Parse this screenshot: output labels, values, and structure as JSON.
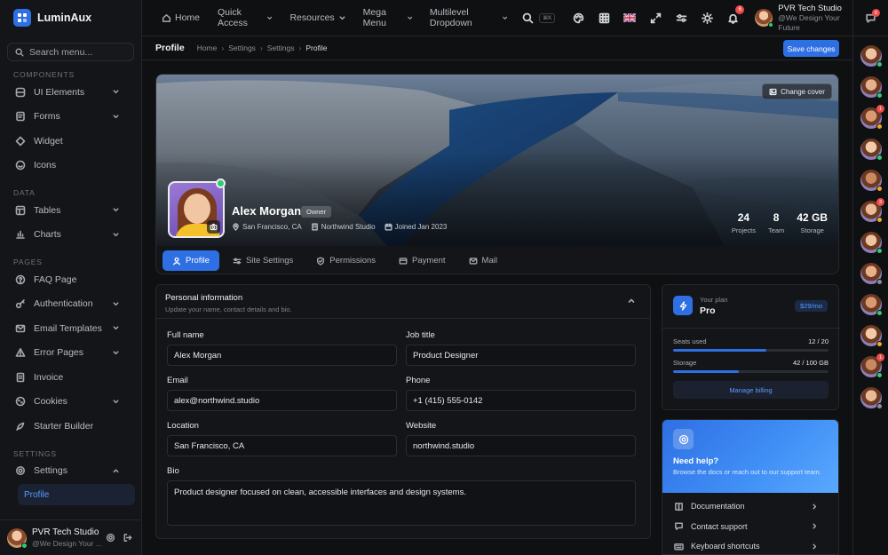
{
  "brand": {
    "name": "LuminAux"
  },
  "sidebar": {
    "search_placeholder": "Search menu...",
    "sections": {
      "components": "COMPONENTS",
      "data": "DATA",
      "pages": "PAGES",
      "settings": "SETTINGS"
    },
    "components": [
      {
        "label": "UI Elements",
        "icon": "grid-icon",
        "chevron": true
      },
      {
        "label": "Forms",
        "icon": "form-icon",
        "chevron": true
      },
      {
        "label": "Widget",
        "icon": "widget-icon",
        "chevron": false
      },
      {
        "label": "Icons",
        "icon": "smile-icon",
        "chevron": false
      }
    ],
    "data": [
      {
        "label": "Tables",
        "icon": "table-icon",
        "chevron": true
      },
      {
        "label": "Charts",
        "icon": "chart-icon",
        "chevron": true
      }
    ],
    "pages": [
      {
        "label": "FAQ Page",
        "icon": "help-circle-icon",
        "chevron": false
      },
      {
        "label": "Authentication",
        "icon": "key-icon",
        "chevron": true
      },
      {
        "label": "Email Templates",
        "icon": "mail-icon",
        "chevron": true
      },
      {
        "label": "Error Pages",
        "icon": "alert-icon",
        "chevron": true
      },
      {
        "label": "Invoice",
        "icon": "invoice-icon",
        "chevron": false
      },
      {
        "label": "Cookies",
        "icon": "cookie-icon",
        "chevron": true
      },
      {
        "label": "Starter Builder",
        "icon": "rocket-icon",
        "chevron": false
      }
    ],
    "settings": {
      "label": "Settings",
      "sub_active": "Profile"
    },
    "user": {
      "name": "PVR Tech Studio",
      "sub": "@We Design Your ..."
    }
  },
  "topbar": {
    "nav": [
      {
        "label": "Home",
        "icon": "home-icon",
        "chevron": false
      },
      {
        "label": "Quick Access",
        "chevron": true
      },
      {
        "label": "Resources",
        "chevron": true
      },
      {
        "label": "Mega Menu",
        "chevron": true
      },
      {
        "label": "Multilevel Dropdown",
        "chevron": true
      }
    ],
    "search_kbd": "⌘K",
    "notifications_count": "6",
    "user": {
      "name": "PVR Tech Studio",
      "sub": "@We Design Your Future"
    }
  },
  "rail": {
    "chat_badge": "6",
    "avatars": [
      {
        "status": "#2ecc71",
        "badge": ""
      },
      {
        "status": "#2ecc71",
        "badge": ""
      },
      {
        "status": "#f5a623",
        "badge": "1"
      },
      {
        "status": "#2ecc71",
        "badge": ""
      },
      {
        "status": "#f5a623",
        "badge": ""
      },
      {
        "status": "#f5a623",
        "badge": "3"
      },
      {
        "status": "#2ecc71",
        "badge": ""
      },
      {
        "status": "#8b9098",
        "badge": ""
      },
      {
        "status": "#2ecc71",
        "badge": ""
      },
      {
        "status": "#f5a623",
        "badge": ""
      },
      {
        "status": "#2ecc71",
        "badge": "1"
      },
      {
        "status": "#8b9098",
        "badge": ""
      }
    ]
  },
  "page": {
    "title": "Profile",
    "breadcrumb": [
      "Home",
      "Settings",
      "Settings",
      "Profile"
    ],
    "save_label": "Save changes"
  },
  "profile": {
    "change_cover": "Change cover",
    "name": "Alex Morgan",
    "role_badge": "Owner",
    "location": "San Francisco, CA",
    "company": "Northwind Studio",
    "joined": "Joined Jan 2023",
    "stats": [
      {
        "value": "24",
        "label": "Projects"
      },
      {
        "value": "8",
        "label": "Team"
      },
      {
        "value": "42 GB",
        "label": "Storage"
      }
    ],
    "tabs": [
      {
        "label": "Profile",
        "icon": "user-icon",
        "active": true
      },
      {
        "label": "Site Settings",
        "icon": "sliders-icon",
        "active": false
      },
      {
        "label": "Permissions",
        "icon": "shield-icon",
        "active": false
      },
      {
        "label": "Payment",
        "icon": "card-icon",
        "active": false
      },
      {
        "label": "Mail",
        "icon": "mail-icon",
        "active": false
      }
    ]
  },
  "personal": {
    "title": "Personal information",
    "subtitle": "Update your name, contact details and bio.",
    "fields": {
      "full_name": {
        "label": "Full name",
        "value": "Alex Morgan"
      },
      "job_title": {
        "label": "Job title",
        "value": "Product Designer"
      },
      "email": {
        "label": "Email",
        "value": "alex@northwind.studio"
      },
      "phone": {
        "label": "Phone",
        "value": "+1 (415) 555-0142"
      },
      "location": {
        "label": "Location",
        "value": "San Francisco, CA"
      },
      "website": {
        "label": "Website",
        "value": "northwind.studio"
      },
      "bio": {
        "label": "Bio",
        "value": "Product designer focused on clean, accessible interfaces and design systems."
      }
    }
  },
  "plan": {
    "label": "Your plan",
    "name": "Pro",
    "price": "$29/mo",
    "seats": {
      "label": "Seats used",
      "value": "12 / 20",
      "fraction": 0.6
    },
    "storage": {
      "label": "Storage",
      "value": "42 / 100 GB",
      "fraction": 0.42
    },
    "manage": "Manage billing"
  },
  "help": {
    "title": "Need help?",
    "subtitle": "Browse the docs or reach out to our support team.",
    "links": [
      {
        "label": "Documentation",
        "icon": "book-icon"
      },
      {
        "label": "Contact support",
        "icon": "chat-icon"
      },
      {
        "label": "Keyboard shortcuts",
        "icon": "keyboard-icon"
      }
    ]
  },
  "colors": {
    "accent": "#2f6fe4",
    "online": "#2ecc71",
    "badge": "#ef4b4b"
  }
}
